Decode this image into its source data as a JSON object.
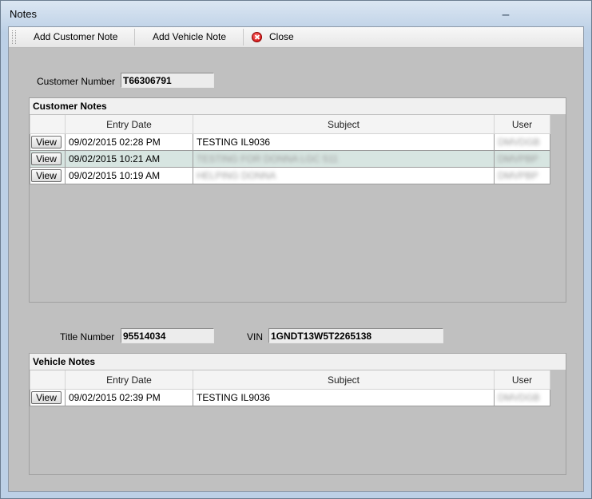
{
  "window": {
    "title": "Notes"
  },
  "toolbar": {
    "add_customer_note": "Add Customer Note",
    "add_vehicle_note": "Add Vehicle Note",
    "close": "Close"
  },
  "customer": {
    "number_label": "Customer Number",
    "number_value": "T66306791"
  },
  "customer_notes": {
    "title": "Customer Notes",
    "columns": [
      "",
      "Entry Date",
      "Subject",
      "User"
    ],
    "rows": [
      {
        "button": "View",
        "date": "09/02/2015 02:28 PM",
        "subject": "TESTING IL9036",
        "user": "DMVDGB"
      },
      {
        "button": "View",
        "date": "09/02/2015 10:21 AM",
        "subject": "TESTING FOR DONNA LGC 511",
        "user": "DMVPBP"
      },
      {
        "button": "View",
        "date": "09/02/2015 10:19 AM",
        "subject": "HELPING DONNA",
        "user": "DMVPBP"
      }
    ]
  },
  "vehicle": {
    "title_label": "Title Number",
    "title_value": "95514034",
    "vin_label": "VIN",
    "vin_value": "1GNDT13W5T2265138"
  },
  "vehicle_notes": {
    "title": "Vehicle Notes",
    "columns": [
      "",
      "Entry Date",
      "Subject",
      "User"
    ],
    "rows": [
      {
        "button": "View",
        "date": "09/02/2015 02:39 PM",
        "subject": "TESTING IL9036",
        "user": "DMVDGB"
      }
    ]
  }
}
